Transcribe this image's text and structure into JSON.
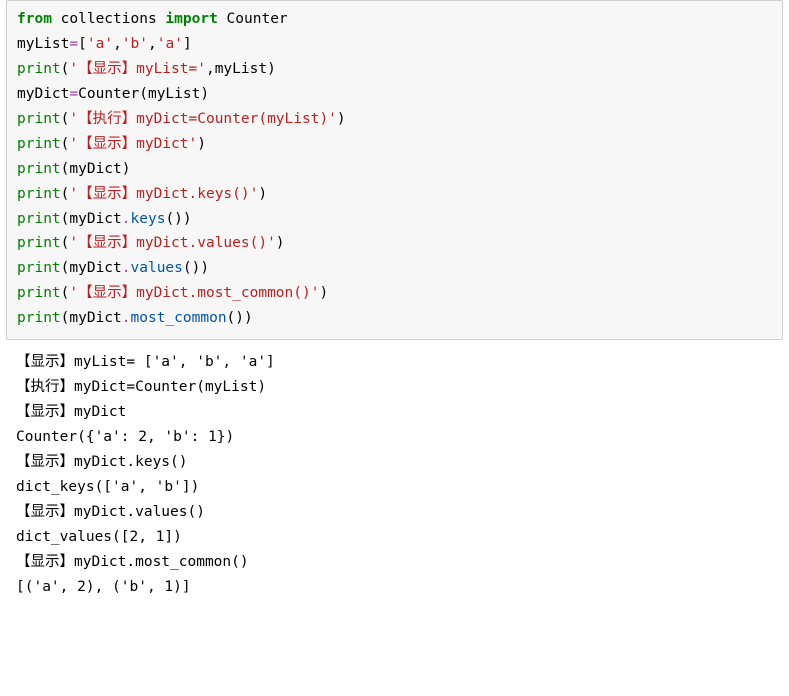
{
  "code": {
    "l1": {
      "kw_from": "from",
      "sp1": " ",
      "mod": "collections",
      "sp2": " ",
      "kw_import": "import",
      "sp3": " ",
      "cls": "Counter"
    },
    "l2": {
      "name": "myList",
      "op": "=",
      "val": "['a','b','a']"
    },
    "l3": {
      "fn": "print",
      "open": "(",
      "str": "'【显示】myList='",
      "comma": ",",
      "arg": "myList",
      "close": ")"
    },
    "l4": {
      "name": "myDict",
      "op": "=",
      "call1": "Counter(myList)"
    },
    "l5": {
      "fn": "print",
      "open": "(",
      "str": "'【执行】myDict=Counter(myList)'",
      "close": ")"
    },
    "l6": {
      "fn": "print",
      "open": "(",
      "str": "'【显示】myDict'",
      "close": ")"
    },
    "l7": {
      "fn": "print",
      "open": "(",
      "arg": "myDict",
      "close": ")"
    },
    "l8": {
      "fn": "print",
      "open": "(",
      "str": "'【显示】myDict.keys()'",
      "close": ")"
    },
    "l9": {
      "fn": "print",
      "open": "(",
      "obj": "myDict",
      "dot": ".",
      "meth": "keys",
      "paren": "()",
      "close": ")"
    },
    "l10": {
      "fn": "print",
      "open": "(",
      "str": "'【显示】myDict.values()'",
      "close": ")"
    },
    "l11": {
      "fn": "print",
      "open": "(",
      "obj": "myDict",
      "dot": ".",
      "meth": "values",
      "paren": "()",
      "close": ")"
    },
    "l12": {
      "fn": "print",
      "open": "(",
      "str": "'【显示】myDict.most_common()'",
      "close": ")"
    },
    "l13": {
      "fn": "print",
      "open": "(",
      "obj": "myDict",
      "dot": ".",
      "meth": "most_common",
      "paren": "()",
      "close": ")"
    }
  },
  "output": {
    "o1": "【显示】myList= ['a', 'b', 'a']",
    "o2": "【执行】myDict=Counter(myList)",
    "o3": "【显示】myDict",
    "o4": "Counter({'a': 2, 'b': 1})",
    "o5": "【显示】myDict.keys()",
    "o6": "dict_keys(['a', 'b'])",
    "o7": "【显示】myDict.values()",
    "o8": "dict_values([2, 1])",
    "o9": "【显示】myDict.most_common()",
    "o10": "[('a', 2), ('b', 1)]"
  }
}
